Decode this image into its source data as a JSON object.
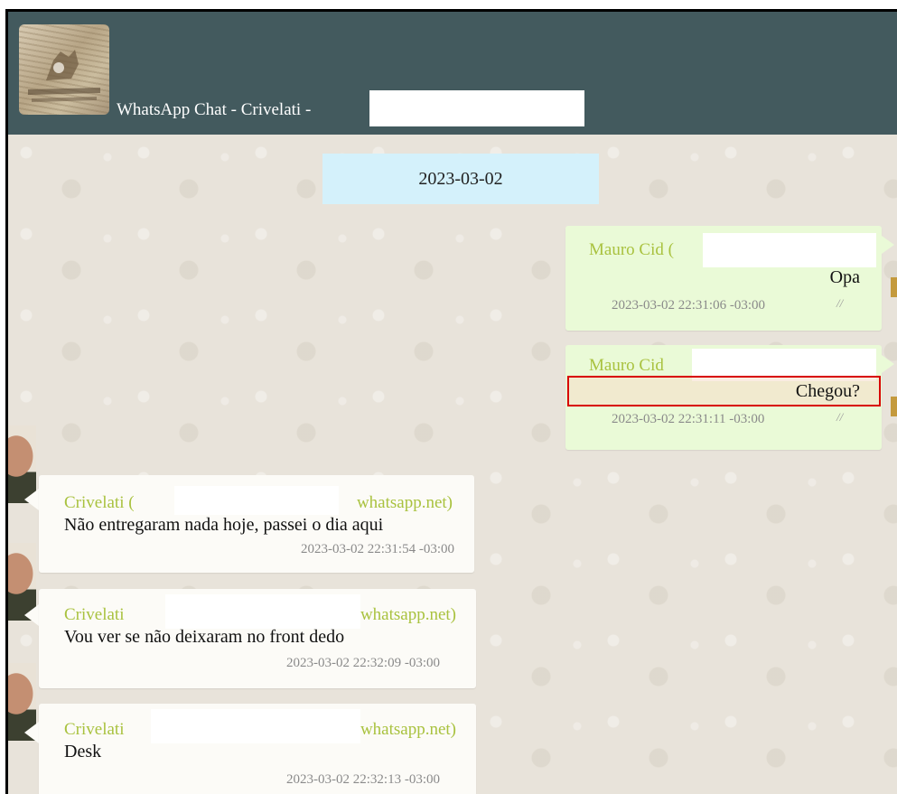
{
  "header": {
    "title": "WhatsApp Chat - Crivelati -",
    "header_color": "#435a5e"
  },
  "chat": {
    "date_separator": "2023-03-02",
    "messages": [
      {
        "direction": "outgoing",
        "sender": "Mauro Cid (",
        "text": "Opa",
        "timestamp": "2023-03-02 22:31:06 -03:00",
        "status": "read"
      },
      {
        "direction": "outgoing",
        "sender": "Mauro Cid",
        "text": "Chegou?",
        "timestamp": "2023-03-02 22:31:11 -03:00",
        "status": "read",
        "highlighted": true
      },
      {
        "direction": "incoming",
        "sender": "Crivelati (",
        "sender_suffix": "whatsapp.net)",
        "text": "Não entregaram nada hoje, passei o dia aqui",
        "timestamp": "2023-03-02 22:31:54 -03:00"
      },
      {
        "direction": "incoming",
        "sender": "Crivelati",
        "sender_suffix": "whatsapp.net)",
        "text": "Vou ver se não deixaram no front dedo",
        "timestamp": "2023-03-02 22:32:09 -03:00"
      },
      {
        "direction": "incoming",
        "sender": "Crivelati",
        "sender_suffix": "whatsapp.net)",
        "text": "Desk",
        "timestamp": "2023-03-02 22:32:13 -03:00"
      }
    ]
  },
  "colors": {
    "outgoing_bubble": "#eafad7",
    "incoming_bubble": "#fcfbf7",
    "sender_name": "#a9c23f",
    "date_pill": "#d4f1fb",
    "highlight_border": "#d80000"
  },
  "icons": {
    "read_ticks": "double-check-icon",
    "group_avatar": "group-avatar-image",
    "contact_avatar": "contact-avatar-image"
  }
}
